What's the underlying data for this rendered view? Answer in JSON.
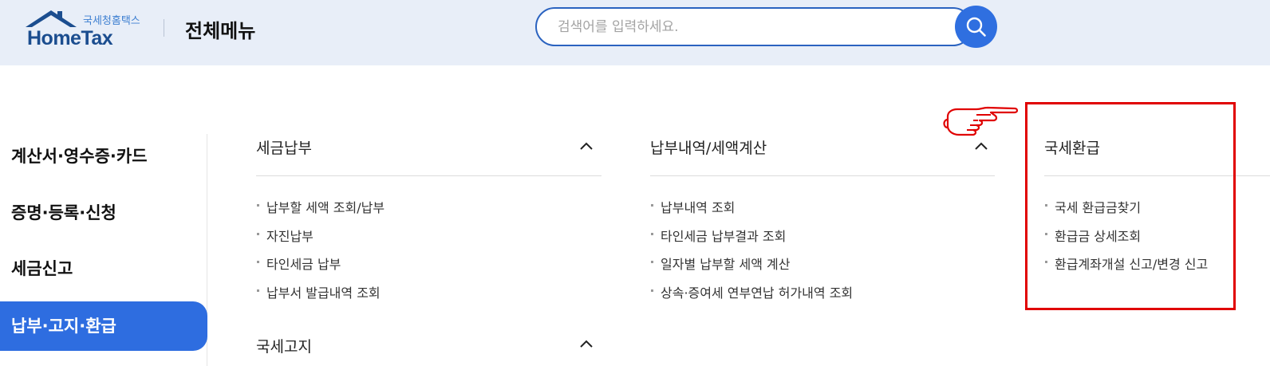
{
  "header": {
    "logo_sub": "국세청홈택스",
    "logo_main": "HomeTax",
    "page_title": "전체메뉴",
    "search_placeholder": "검색어를 입력하세요.",
    "search_value": ""
  },
  "sidebar": {
    "items": [
      {
        "label": "계산서·영수증·카드",
        "active": false
      },
      {
        "label": "증명·등록·신청",
        "active": false
      },
      {
        "label": "세금신고",
        "active": false
      },
      {
        "label": "납부·고지·환급",
        "active": true
      }
    ]
  },
  "sections": [
    {
      "title": "세금납부",
      "links": [
        "납부할 세액 조회/납부",
        "자진납부",
        "타인세금 납부",
        "납부서 발급내역 조회"
      ]
    },
    {
      "title": "납부내역/세액계산",
      "links": [
        "납부내역 조회",
        "타인세금 납부결과 조회",
        "일자별 납부할 세액 계산",
        "상속·증여세 연부연납 허가내역 조회"
      ]
    },
    {
      "title": "국세환급",
      "links": [
        "국세 환급금찾기",
        "환급금 상세조회",
        "환급계좌개설 신고/변경 신고"
      ]
    },
    {
      "title": "국세고지",
      "links": []
    }
  ],
  "colors": {
    "header_bg": "#e8eef8",
    "accent": "#2e6de0",
    "highlight": "#e00000"
  },
  "icons": [
    "search-icon",
    "chevron-up-icon",
    "pointing-hand-icon",
    "house-roof-icon"
  ]
}
